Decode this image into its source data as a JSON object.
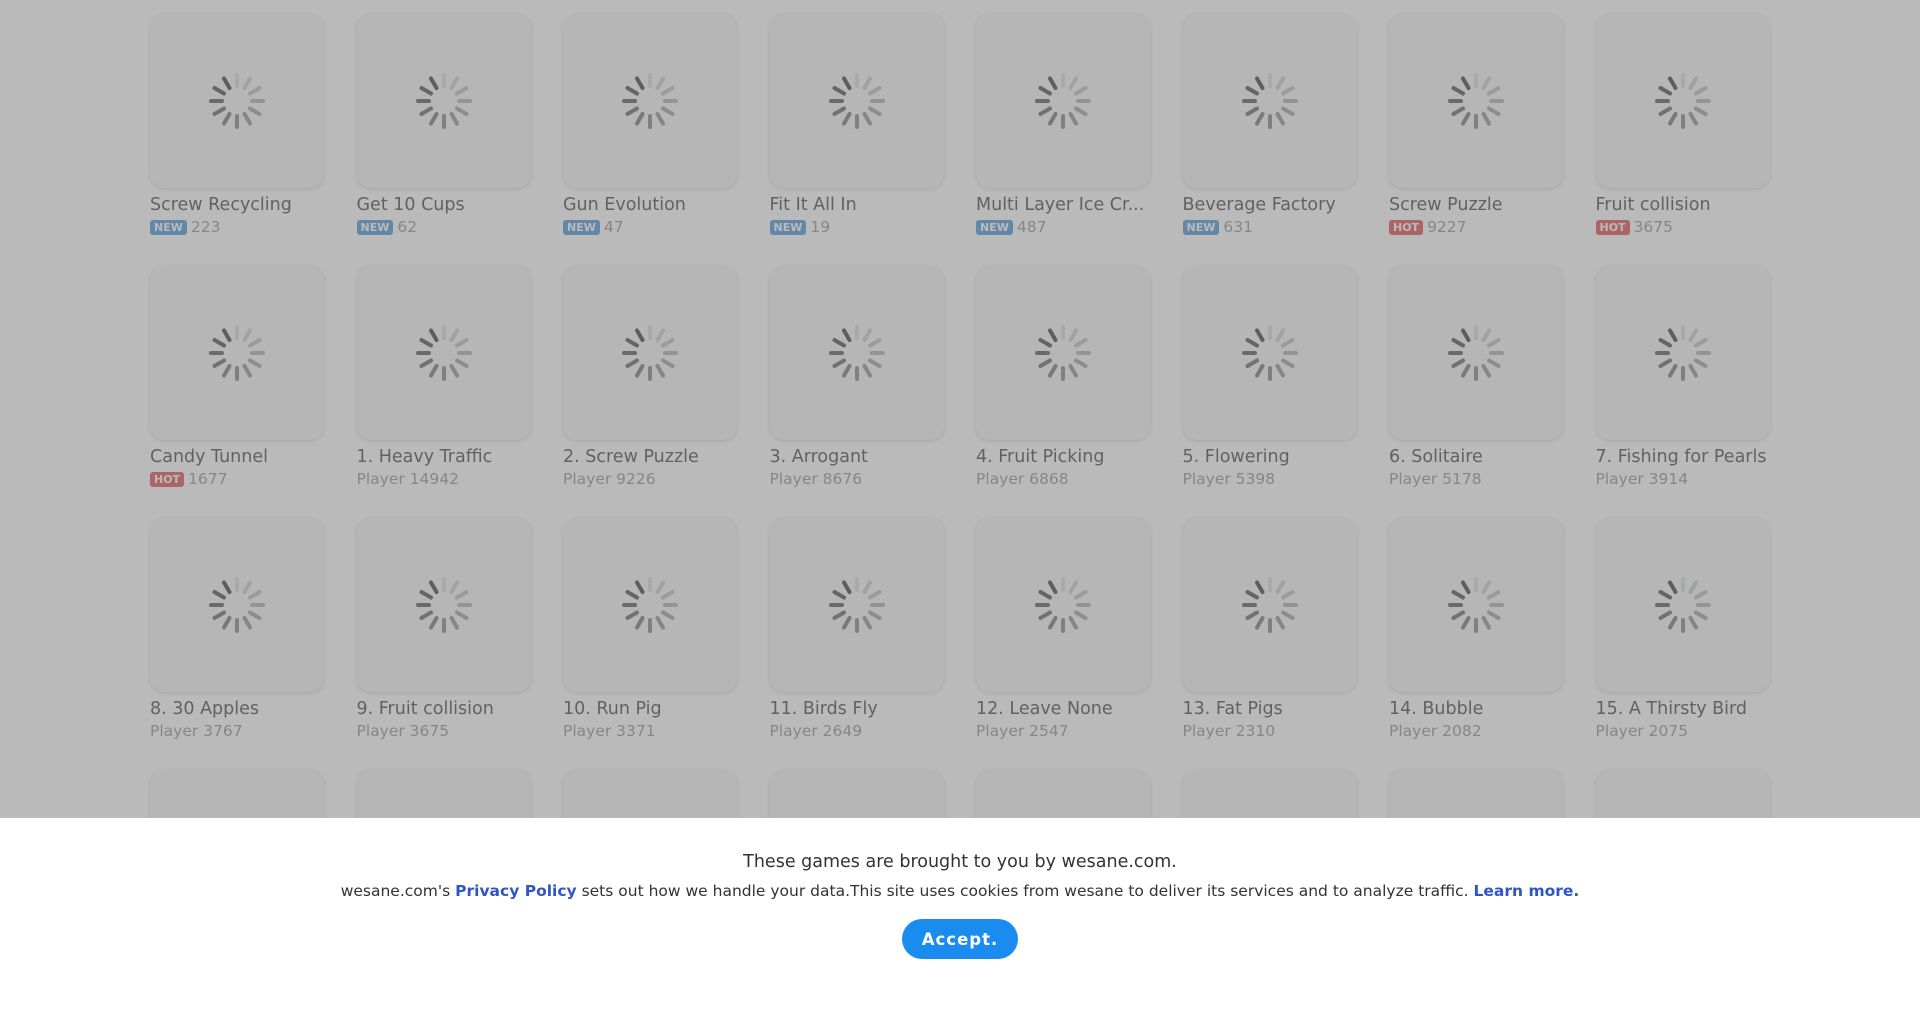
{
  "games": [
    {
      "title": "Screw Recycling",
      "badge": "NEW",
      "badge_type": "new",
      "meta": "223"
    },
    {
      "title": "Get 10 Cups",
      "badge": "NEW",
      "badge_type": "new",
      "meta": "62"
    },
    {
      "title": "Gun Evolution",
      "badge": "NEW",
      "badge_type": "new",
      "meta": "47"
    },
    {
      "title": "Fit It All In",
      "badge": "NEW",
      "badge_type": "new",
      "meta": "19"
    },
    {
      "title": "Multi Layer Ice Cr...",
      "badge": "NEW",
      "badge_type": "new",
      "meta": "487"
    },
    {
      "title": "Beverage Factory",
      "badge": "NEW",
      "badge_type": "new",
      "meta": "631"
    },
    {
      "title": " Screw Puzzle",
      "badge": "HOT",
      "badge_type": "hot",
      "meta": "9227"
    },
    {
      "title": " Fruit collision",
      "badge": "HOT",
      "badge_type": "hot",
      "meta": "3675"
    },
    {
      "title": " Candy Tunnel",
      "badge": "HOT",
      "badge_type": "hot",
      "meta": "1677"
    },
    {
      "title": "1. Heavy Traffic",
      "badge": "",
      "badge_type": "",
      "meta": "Player 14942"
    },
    {
      "title": "2. Screw Puzzle",
      "badge": "",
      "badge_type": "",
      "meta": "Player 9226"
    },
    {
      "title": "3. Arrogant",
      "badge": "",
      "badge_type": "",
      "meta": "Player 8676"
    },
    {
      "title": "4. Fruit Picking",
      "badge": "",
      "badge_type": "",
      "meta": "Player 6868"
    },
    {
      "title": "5. Flowering",
      "badge": "",
      "badge_type": "",
      "meta": "Player 5398"
    },
    {
      "title": "6. Solitaire",
      "badge": "",
      "badge_type": "",
      "meta": "Player 5178"
    },
    {
      "title": "7. Fishing for Pearls",
      "badge": "",
      "badge_type": "",
      "meta": "Player 3914"
    },
    {
      "title": "8. 30 Apples",
      "badge": "",
      "badge_type": "",
      "meta": "Player 3767"
    },
    {
      "title": "9. Fruit collision",
      "badge": "",
      "badge_type": "",
      "meta": "Player 3675"
    },
    {
      "title": "10. Run Pig",
      "badge": "",
      "badge_type": "",
      "meta": "Player 3371"
    },
    {
      "title": "11. Birds Fly",
      "badge": "",
      "badge_type": "",
      "meta": "Player 2649"
    },
    {
      "title": "12. Leave None",
      "badge": "",
      "badge_type": "",
      "meta": "Player 2547"
    },
    {
      "title": "13. Fat Pigs",
      "badge": "",
      "badge_type": "",
      "meta": "Player 2310"
    },
    {
      "title": "14. Bubble",
      "badge": "",
      "badge_type": "",
      "meta": "Player 2082"
    },
    {
      "title": "15. A Thirsty Bird",
      "badge": "",
      "badge_type": "",
      "meta": "Player 2075"
    },
    {
      "title": "",
      "badge": "",
      "badge_type": "",
      "meta": ""
    },
    {
      "title": "",
      "badge": "",
      "badge_type": "",
      "meta": ""
    },
    {
      "title": "",
      "badge": "",
      "badge_type": "",
      "meta": ""
    },
    {
      "title": "",
      "badge": "",
      "badge_type": "",
      "meta": ""
    },
    {
      "title": "",
      "badge": "",
      "badge_type": "",
      "meta": ""
    },
    {
      "title": "",
      "badge": "",
      "badge_type": "",
      "meta": ""
    },
    {
      "title": "",
      "badge": "",
      "badge_type": "",
      "meta": ""
    },
    {
      "title": "",
      "badge": "",
      "badge_type": "",
      "meta": ""
    }
  ],
  "thumbnail_icon": "loading-spinner-icon",
  "consent": {
    "title": "These games are brought to you by wesane.com.",
    "body_prefix": "wesane.com's ",
    "privacy_link": "Privacy Policy",
    "body_middle": " sets out how we handle your data.This site uses cookies from wesane to deliver its services and to analyze traffic. ",
    "learn_more": "Learn more.",
    "accept_label": "Accept."
  },
  "colors": {
    "new_badge": "#3f8fd8",
    "hot_badge": "#e04040",
    "accept_button": "#1a8cf0",
    "link": "#2f55c7"
  }
}
